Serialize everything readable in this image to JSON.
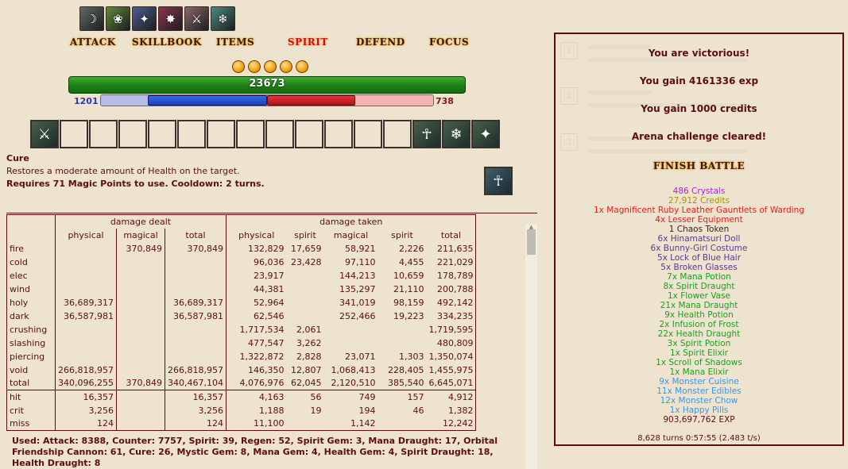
{
  "buffs": [
    {
      "name": "buff-1",
      "icon": "☽",
      "color": "#5e6a66"
    },
    {
      "name": "buff-2",
      "icon": "❀",
      "color": "#5f8a3a"
    },
    {
      "name": "buff-3",
      "icon": "✦",
      "color": "#4a5e90"
    },
    {
      "name": "buff-4",
      "icon": "✸",
      "color": "#8a3450"
    },
    {
      "name": "buff-5",
      "icon": "⚔",
      "color": "#8a6a6a"
    },
    {
      "name": "buff-6",
      "icon": "❄",
      "color": "#4c8a86"
    }
  ],
  "menu": {
    "attack": "ATTACK",
    "skillbook": "SKILLBOOK",
    "items": "ITEMS",
    "spirit": "SPIRIT",
    "defend": "DEFEND",
    "focus": "FOCUS",
    "active": "spirit"
  },
  "charges": {
    "count": 5
  },
  "bars": {
    "hp": "23673",
    "mp": "1201",
    "sp": "738",
    "mp_fraction": 0.72,
    "sp_fraction": 0.53
  },
  "quickbar": {
    "slots": [
      {
        "filled": true,
        "icon": "⚔"
      },
      {
        "filled": false,
        "icon": ""
      },
      {
        "filled": false,
        "icon": ""
      },
      {
        "filled": false,
        "icon": ""
      },
      {
        "filled": false,
        "icon": ""
      },
      {
        "filled": false,
        "icon": ""
      },
      {
        "filled": false,
        "icon": ""
      },
      {
        "filled": false,
        "icon": ""
      },
      {
        "filled": false,
        "icon": ""
      },
      {
        "filled": false,
        "icon": ""
      },
      {
        "filled": false,
        "icon": ""
      },
      {
        "filled": false,
        "icon": ""
      },
      {
        "filled": false,
        "icon": ""
      },
      {
        "filled": true,
        "icon": "☥"
      },
      {
        "filled": true,
        "icon": "❄"
      },
      {
        "filled": true,
        "icon": "✦"
      }
    ]
  },
  "skill": {
    "name": "Cure",
    "description": "Restores a moderate amount of Health on the target.",
    "requirement": "Requires 71 Magic Points to use. Cooldown: 2 turns.",
    "icon": "☥"
  },
  "stats": {
    "group_dealt": "damage dealt",
    "group_taken": "damage taken",
    "columns": [
      "physical",
      "magical",
      "total",
      "physical",
      "spirit",
      "magical",
      "spirit",
      "total"
    ],
    "rows": [
      {
        "label": "fire",
        "cells": [
          "",
          "370,849",
          "370,849",
          "132,829",
          "17,659",
          "58,921",
          "2,226",
          "211,635"
        ]
      },
      {
        "label": "cold",
        "cells": [
          "",
          "",
          "",
          "96,036",
          "23,428",
          "97,110",
          "4,455",
          "221,029"
        ]
      },
      {
        "label": "elec",
        "cells": [
          "",
          "",
          "",
          "23,917",
          "",
          "144,213",
          "10,659",
          "178,789"
        ]
      },
      {
        "label": "wind",
        "cells": [
          "",
          "",
          "",
          "44,381",
          "",
          "135,297",
          "21,110",
          "200,788"
        ]
      },
      {
        "label": "holy",
        "cells": [
          "36,689,317",
          "",
          "36,689,317",
          "52,964",
          "",
          "341,019",
          "98,159",
          "492,142"
        ]
      },
      {
        "label": "dark",
        "cells": [
          "36,587,981",
          "",
          "36,587,981",
          "62,546",
          "",
          "252,466",
          "19,223",
          "334,235"
        ]
      },
      {
        "label": "crushing",
        "cells": [
          "",
          "",
          "",
          "1,717,534",
          "2,061",
          "",
          "",
          "1,719,595"
        ]
      },
      {
        "label": "slashing",
        "cells": [
          "",
          "",
          "",
          "477,547",
          "3,262",
          "",
          "",
          "480,809"
        ]
      },
      {
        "label": "piercing",
        "cells": [
          "",
          "",
          "",
          "1,322,872",
          "2,828",
          "23,071",
          "1,303",
          "1,350,074"
        ]
      },
      {
        "label": "void",
        "cells": [
          "266,818,957",
          "",
          "266,818,957",
          "146,350",
          "12,807",
          "1,068,413",
          "228,405",
          "1,455,975"
        ]
      },
      {
        "label": "total",
        "cells": [
          "340,096,255",
          "370,849",
          "340,467,104",
          "4,076,976",
          "62,045",
          "2,120,510",
          "385,540",
          "6,645,071"
        ]
      }
    ],
    "hit_rows": [
      {
        "label": "hit",
        "cells": [
          "16,357",
          "",
          "16,357",
          "4,163",
          "56",
          "749",
          "157",
          "4,912"
        ]
      },
      {
        "label": "crit",
        "cells": [
          "3,256",
          "",
          "3,256",
          "1,188",
          "19",
          "194",
          "46",
          "1,382"
        ]
      },
      {
        "label": "miss",
        "cells": [
          "124",
          "",
          "124",
          "11,100",
          "",
          "1,142",
          "",
          "12,242"
        ]
      }
    ]
  },
  "usage": "Used: Attack: 8388, Counter: 7757, Spirit: 39, Regen: 52, Spirit Gem: 3, Mana Draught: 17, Orbital Friendship Cannon: 61, Cure: 26, Mystic Gem: 8, Mana Gem: 4, Health Gem: 4, Spirit Draught: 18, Health Draught: 8",
  "results": {
    "victory": "You are victorious!",
    "exp": "You gain 4161336 exp",
    "credits": "You gain 1000 credits",
    "arena": "Arena challenge cleared!",
    "finish": "FINISH BATTLE"
  },
  "drops": [
    {
      "text": "486 Crystals",
      "color": "#b01ecc"
    },
    {
      "text": "27,912 Credits",
      "color": "#a89400"
    },
    {
      "text": "1x Magnificent Ruby Leather Gauntlets of Warding",
      "color": "#e02020"
    },
    {
      "text": "4x Lesser Equipment",
      "color": "#e02020"
    },
    {
      "text": "1 Chaos Token",
      "color": "#3a2020"
    },
    {
      "text": "6x Hinamatsuri Doll",
      "color": "#5a3a8c"
    },
    {
      "text": "6x Bunny-Girl Costume",
      "color": "#5a3a8c"
    },
    {
      "text": "5x Lock of Blue Hair",
      "color": "#5a3a8c"
    },
    {
      "text": "5x Broken Glasses",
      "color": "#5a3a8c"
    },
    {
      "text": "7x Mana Potion",
      "color": "#1ea01e"
    },
    {
      "text": "8x Spirit Draught",
      "color": "#1ea01e"
    },
    {
      "text": "1x Flower Vase",
      "color": "#1ea01e"
    },
    {
      "text": "21x Mana Draught",
      "color": "#1ea01e"
    },
    {
      "text": "9x Health Potion",
      "color": "#1ea01e"
    },
    {
      "text": "2x Infusion of Frost",
      "color": "#1ea01e"
    },
    {
      "text": "22x Health Draught",
      "color": "#1ea01e"
    },
    {
      "text": "3x Spirit Potion",
      "color": "#1ea01e"
    },
    {
      "text": "1x Spirit Elixir",
      "color": "#1ea01e"
    },
    {
      "text": "1x Scroll of Shadows",
      "color": "#1ea01e"
    },
    {
      "text": "1x Mana Elixir",
      "color": "#1ea01e"
    },
    {
      "text": "9x Monster Cuisine",
      "color": "#3e96e0"
    },
    {
      "text": "11x Monster Edibles",
      "color": "#3e96e0"
    },
    {
      "text": "12x Monster Chow",
      "color": "#3e96e0"
    },
    {
      "text": "1x Happy Pills",
      "color": "#3e96e0"
    },
    {
      "text": "903,697,762 EXP",
      "color": "#5c0d11"
    }
  ],
  "turns": "8,628 turns 0:57:55 (2.483 t/s)"
}
